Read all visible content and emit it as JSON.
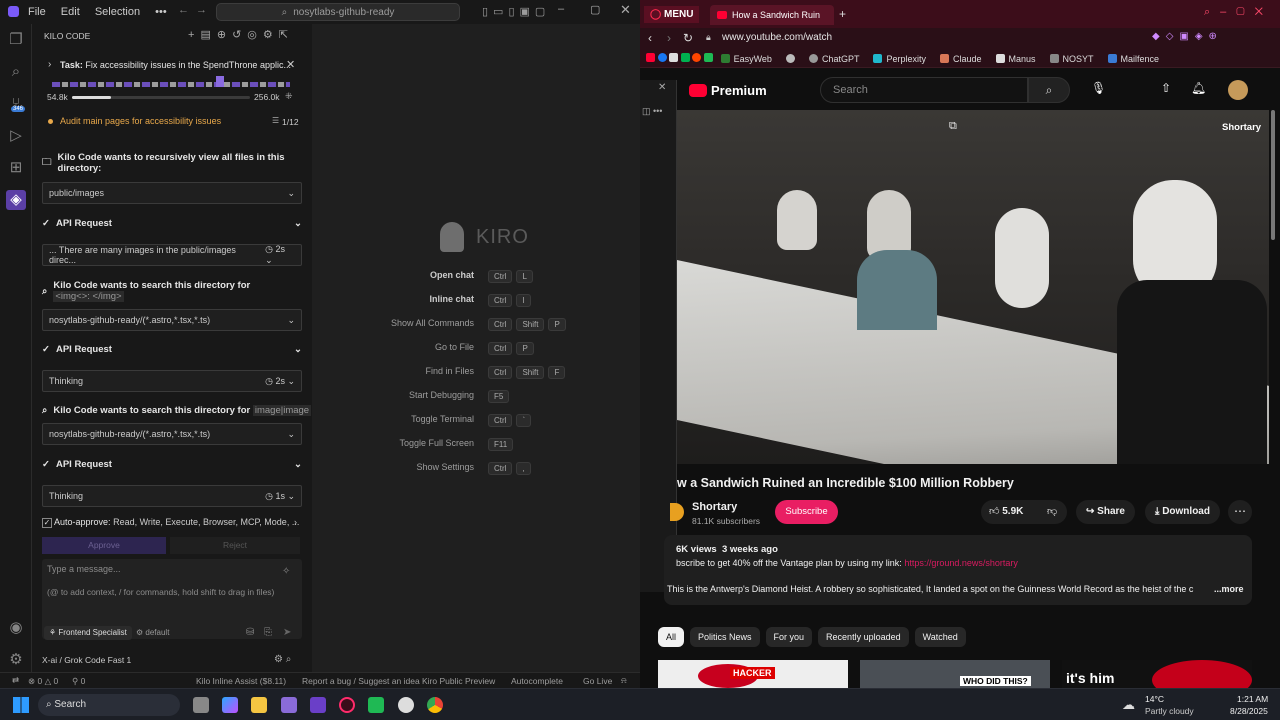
{
  "editor": {
    "menu": [
      "File",
      "Edit",
      "Selection"
    ],
    "search_placeholder": "nosytlabs-github-ready",
    "panel_title": "KILO CODE",
    "task": {
      "label": "Task:",
      "text": "Fix accessibility issues in the SpendThrone applic...",
      "context_used": "54.8k",
      "context_max": "256.0k"
    },
    "todo": {
      "text": "Audit main pages for accessibility issues",
      "count": "1/12"
    },
    "messages": [
      {
        "type": "header",
        "text": "Kilo Code wants to recursively view all files in this directory:"
      },
      {
        "type": "dropdown",
        "text": "public/images"
      },
      {
        "type": "api",
        "text": "API Request"
      },
      {
        "type": "dropdown",
        "text": "... There are many images in the public/images direc...",
        "time": "2s"
      },
      {
        "type": "header",
        "text": "Kilo Code wants to search this directory for",
        "code": "<img<>: </img>"
      },
      {
        "type": "dropdown",
        "text": "nosytlabs-github-ready/(*.astro,*.tsx,*.ts)"
      },
      {
        "type": "api",
        "text": "API Request"
      },
      {
        "type": "dropdown",
        "text": "Thinking",
        "time": "2s"
      },
      {
        "type": "header",
        "text": "Kilo Code wants to search this directory for",
        "code": "image|image"
      },
      {
        "type": "dropdown",
        "text": "nosytlabs-github-ready/(*.astro,*.tsx,*.ts)"
      },
      {
        "type": "api",
        "text": "API Request"
      },
      {
        "type": "dropdown",
        "text": "Thinking",
        "time": "1s"
      }
    ],
    "auto_approve": {
      "label": "Auto-approve:",
      "items": "Read, Write, Execute, Browser, MCP, Mode, ..."
    },
    "approve_label": "Approve",
    "reject_label": "Reject",
    "input_placeholder": "Type a message...",
    "input_hint": "(@ to add context, / for commands, hold shift to drag in files)",
    "mode": "Frontend Specialist",
    "profile": "default",
    "model": "X-ai / Grok Code Fast 1",
    "welcome": {
      "logo_text": "KIRO",
      "shortcuts": [
        {
          "label": "Open chat",
          "keys": [
            "Ctrl",
            "L"
          ]
        },
        {
          "label": "Inline chat",
          "keys": [
            "Ctrl",
            "I"
          ]
        },
        {
          "label": "Show All Commands",
          "keys": [
            "Ctrl",
            "Shift",
            "P"
          ]
        },
        {
          "label": "Go to File",
          "keys": [
            "Ctrl",
            "P"
          ]
        },
        {
          "label": "Find in Files",
          "keys": [
            "Ctrl",
            "Shift",
            "F"
          ]
        },
        {
          "label": "Start Debugging",
          "keys": [
            "F5"
          ]
        },
        {
          "label": "Toggle Terminal",
          "keys": [
            "Ctrl",
            "`"
          ]
        },
        {
          "label": "Toggle Full Screen",
          "keys": [
            "F11"
          ]
        },
        {
          "label": "Show Settings",
          "keys": [
            "Ctrl",
            ","
          ]
        }
      ]
    },
    "status": {
      "errors": "0",
      "warnings": "0",
      "ports": "0",
      "kilo_inline": "Kilo Inline Assist ($8.11)",
      "report": "Report a bug / Suggest an idea",
      "preview": "Kiro Public Preview",
      "autocomplete": "Autocomplete",
      "golive": "Go Live"
    },
    "badge_count": "346"
  },
  "browser": {
    "menu_label": "MENU",
    "tab_title": "How a Sandwich Ruin",
    "url": "www.youtube.com/watch",
    "bookmarks": [
      "EasyWeb",
      "ChatGPT",
      "Perplexity",
      "Claude",
      "Manus",
      "NOSYT",
      "Mailfence"
    ],
    "yt": {
      "brand": "Premium",
      "search_placeholder": "Search",
      "overlay_label": "Shortary",
      "title": "w a Sandwich Ruined an Incredible $100 Million Robbery",
      "channel": "Shortary",
      "subscribers": "81.1K subscribers",
      "subscribe": "Subscribe",
      "likes": "5.9K",
      "share": "Share",
      "download": "Download",
      "views": "6K views  3 weeks ago",
      "desc_line1": "bscribe to get 40% off the Vantage plan by using my link:",
      "desc_link": "https://ground.news/shortary",
      "desc_line2": "This is the Antwerp's Diamond Heist. A robbery so sophisticated, It landed a spot on the Guinness World Record as the heist of the c",
      "more": "...more",
      "chips": [
        "All",
        "Politics News",
        "For you",
        "Recently uploaded",
        "Watched"
      ],
      "thumbs": [
        "HACKER",
        "WHO DID THIS?",
        "it's him"
      ]
    }
  },
  "taskbar": {
    "search": "Search",
    "weather_temp": "14°C",
    "weather_desc": "Partly cloudy",
    "time": "1:21 AM",
    "date": "8/28/2025"
  },
  "colors": {
    "accent": "#6b4fbb",
    "yt_red": "#ff0033",
    "subscribe": "#e91e63",
    "link": "#d81b60",
    "browser_tab": "#3c0d1a"
  }
}
